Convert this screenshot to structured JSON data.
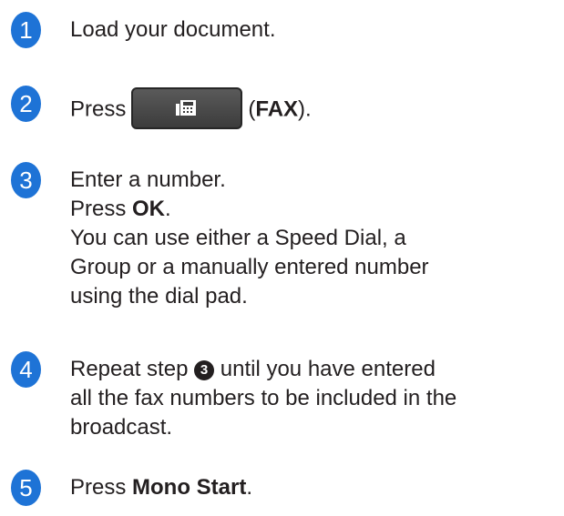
{
  "steps": [
    {
      "number": "1",
      "text": "Load your document."
    },
    {
      "number": "2",
      "before": "Press",
      "paren_open": "(",
      "bold": "FAX",
      "paren_close": ").",
      "button_icon": "fax-icon"
    },
    {
      "number": "3",
      "line1": "Enter a number.",
      "line2_before": "Press ",
      "line2_bold": "OK",
      "line2_after": ".",
      "line3": "You can use either a Speed Dial, a",
      "line4": "Group or a manually entered number",
      "line5": "using the dial pad."
    },
    {
      "number": "4",
      "line1_before": "Repeat step ",
      "ref": "3",
      "line1_after": " until you have entered",
      "line2": "all the fax numbers to be included in the",
      "line3": "broadcast."
    },
    {
      "number": "5",
      "before": "Press ",
      "bold": "Mono Start",
      "after": "."
    }
  ],
  "colors": {
    "badge": "#1e73d6",
    "text": "#231f20",
    "button": "#4a4a4a"
  }
}
